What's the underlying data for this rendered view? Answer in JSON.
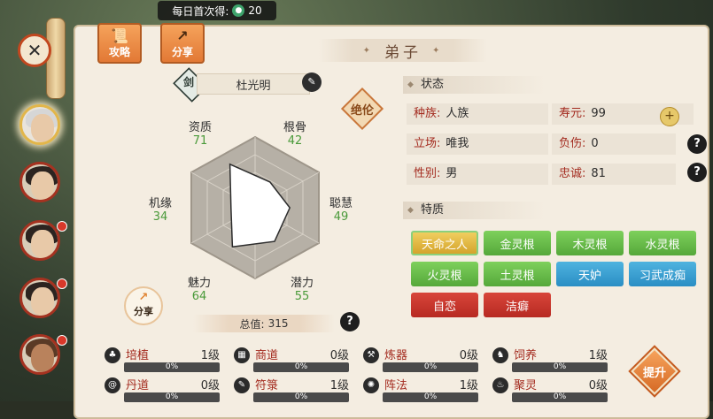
{
  "banner": {
    "label": "每日首次得:",
    "count": "20"
  },
  "tabs": [
    {
      "label": "攻略"
    },
    {
      "label": "分享"
    }
  ],
  "panel_title": "弟子",
  "disciple": {
    "sword_badge": "剑",
    "name": "杜光明",
    "rank_badge": "绝伦"
  },
  "stats": [
    {
      "label": "资质",
      "value": 71
    },
    {
      "label": "根骨",
      "value": 42
    },
    {
      "label": "聪慧",
      "value": 49
    },
    {
      "label": "潜力",
      "value": 55
    },
    {
      "label": "魅力",
      "value": 64
    },
    {
      "label": "机缘",
      "value": 34
    }
  ],
  "total": {
    "label": "总值:",
    "value": "315"
  },
  "share_round": "分享",
  "status": {
    "title": "状态",
    "fields": [
      {
        "key": "种族:",
        "value": "人族"
      },
      {
        "key": "寿元:",
        "value": "99"
      },
      {
        "key": "立场:",
        "value": "唯我"
      },
      {
        "key": "负伤:",
        "value": "0"
      },
      {
        "key": "性别:",
        "value": "男"
      },
      {
        "key": "忠诚:",
        "value": "81"
      }
    ]
  },
  "traits": {
    "title": "特质",
    "items": [
      {
        "label": "天命之人",
        "color": "gold"
      },
      {
        "label": "金灵根",
        "color": "green"
      },
      {
        "label": "木灵根",
        "color": "green"
      },
      {
        "label": "水灵根",
        "color": "green"
      },
      {
        "label": "火灵根",
        "color": "green"
      },
      {
        "label": "土灵根",
        "color": "green"
      },
      {
        "label": "天妒",
        "color": "blue"
      },
      {
        "label": "习武成痴",
        "color": "blue"
      },
      {
        "label": "自恋",
        "color": "red"
      },
      {
        "label": "洁癖",
        "color": "red"
      }
    ]
  },
  "skills": [
    {
      "name": "培植",
      "level": "1级",
      "progress": "0%",
      "icon": "sprout-icon"
    },
    {
      "name": "商道",
      "level": "0级",
      "progress": "0%",
      "icon": "abacus-icon"
    },
    {
      "name": "炼器",
      "level": "0级",
      "progress": "0%",
      "icon": "anvil-icon"
    },
    {
      "name": "饲养",
      "level": "1级",
      "progress": "0%",
      "icon": "beast-icon"
    },
    {
      "name": "丹道",
      "level": "0级",
      "progress": "0%",
      "icon": "swirl-icon"
    },
    {
      "name": "符箓",
      "level": "1级",
      "progress": "0%",
      "icon": "brush-icon"
    },
    {
      "name": "阵法",
      "level": "1级",
      "progress": "0%",
      "icon": "formation-icon"
    },
    {
      "name": "聚灵",
      "level": "0级",
      "progress": "0%",
      "icon": "cauldron-icon"
    }
  ],
  "upgrade_label": "提升",
  "colors": {
    "accent": "#e27935",
    "stat_value": "#4a9a3a",
    "field_key": "#a32a1e"
  }
}
